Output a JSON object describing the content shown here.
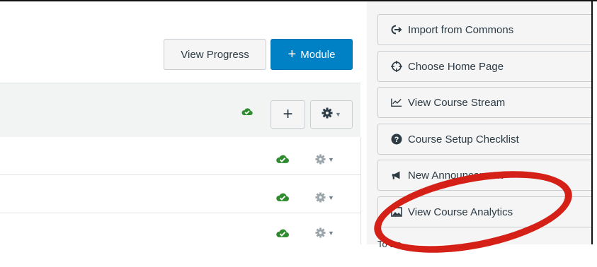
{
  "toolbar": {
    "view_progress_label": "View Progress",
    "add_module_plus": "+",
    "add_module_label": "Module"
  },
  "module_header": {
    "add_item_symbol": "+",
    "gear_icon": "gear-icon",
    "published_icon": "published-cloud-icon"
  },
  "module_items": [
    {
      "published": true
    },
    {
      "published": true
    },
    {
      "published": true
    }
  ],
  "sidebar": {
    "buttons": [
      {
        "icon": "import-icon",
        "label": "Import from Commons"
      },
      {
        "icon": "target-icon",
        "label": "Choose Home Page"
      },
      {
        "icon": "line-chart-icon",
        "label": "View Course Stream"
      },
      {
        "icon": "question-circle-icon",
        "label": "Course Setup Checklist"
      },
      {
        "icon": "megaphone-icon",
        "label": "New Announcement"
      },
      {
        "icon": "image-icon",
        "label": "View Course Analytics"
      }
    ],
    "bottom_label": "To Do"
  },
  "colors": {
    "primary": "#0081c6",
    "success": "#2e8b2e",
    "annotation": "#d52018"
  }
}
